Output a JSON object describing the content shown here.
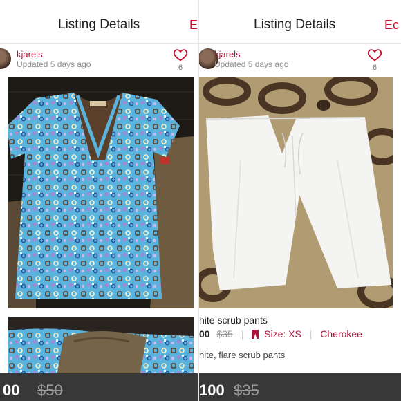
{
  "left": {
    "nav": {
      "title": "Listing Details",
      "edit": "E"
    },
    "user": {
      "name": "kjarels",
      "updated": "Updated 5 days ago",
      "likes": "6"
    },
    "bar": {
      "price": "00",
      "original": "$50"
    }
  },
  "right": {
    "nav": {
      "title": "Listing Details",
      "edit": "Ec"
    },
    "user": {
      "name": "kjarels",
      "updated": "Updated 5 days ago",
      "likes": "6"
    },
    "listing": {
      "title": "hite scrub pants",
      "price": "00",
      "original_price": "$35",
      "size": "Size: XS",
      "brand": "Cherokee",
      "description": "nite, flare scrub pants"
    },
    "bar": {
      "price": "100",
      "original": "$35"
    }
  },
  "colors": {
    "accent": "#c8102e",
    "username": "#a8143a",
    "bar": "#383838"
  },
  "icons": [
    "heart-icon",
    "hanger-icon",
    "avatar"
  ]
}
